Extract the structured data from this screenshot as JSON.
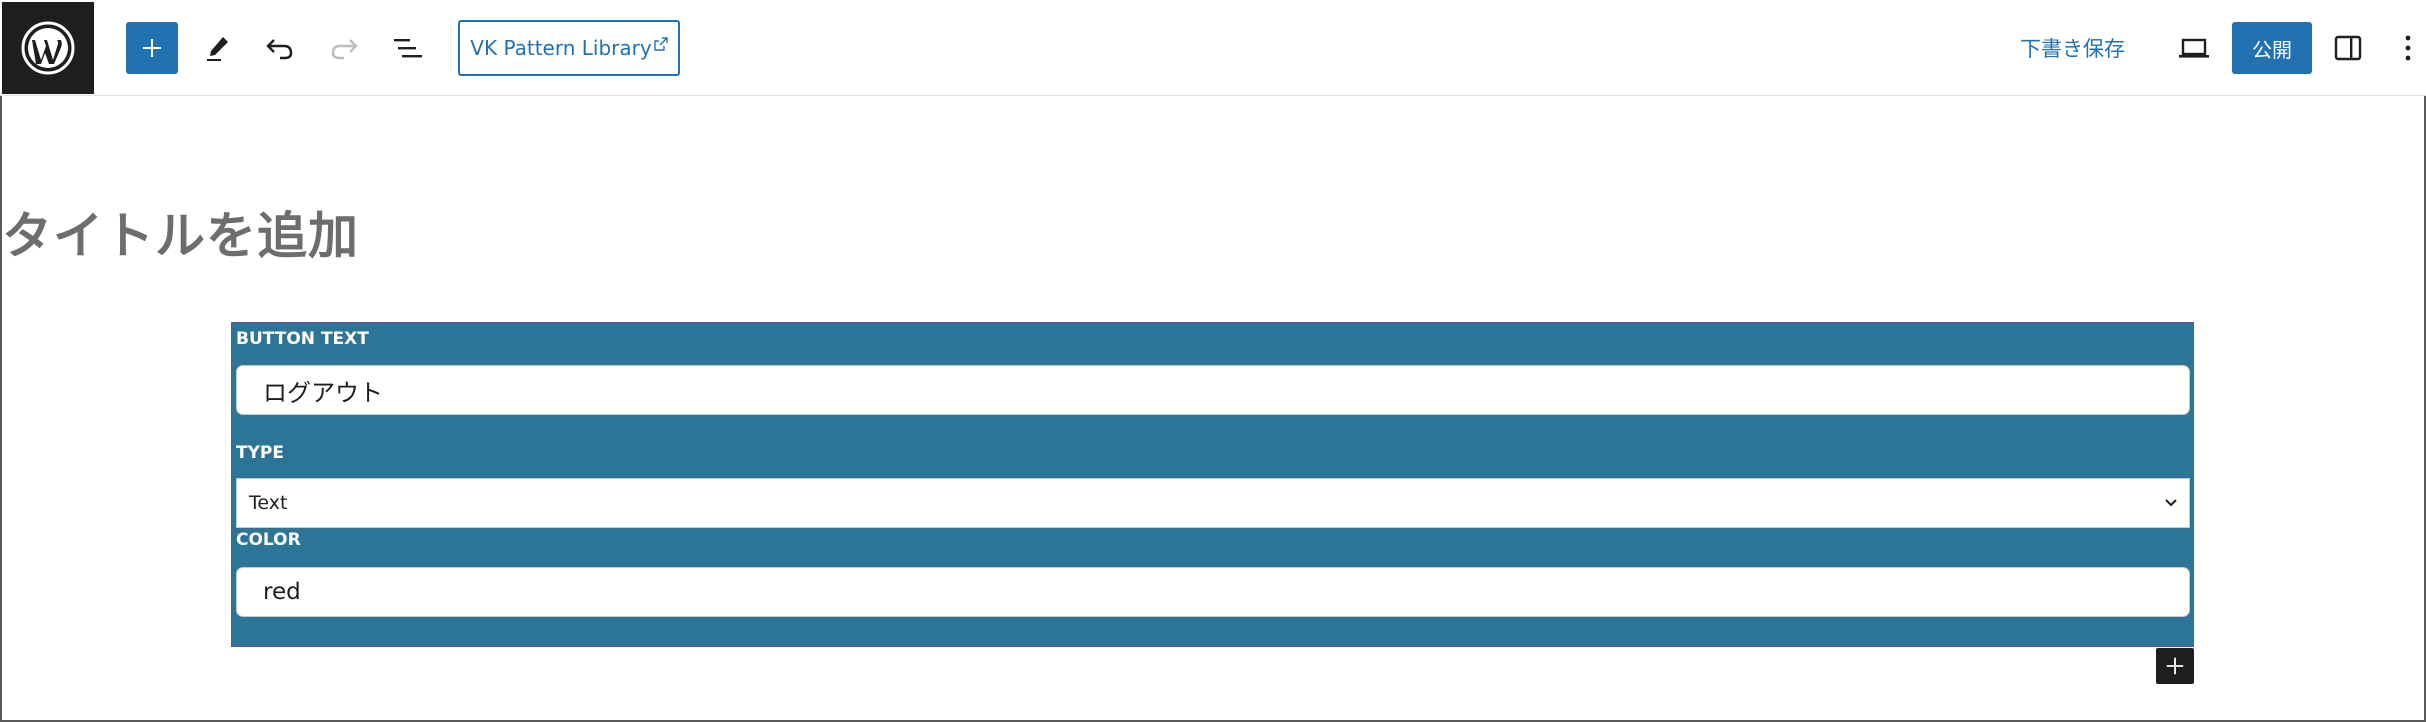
{
  "toolbar": {
    "add_block_icon": "plus-icon",
    "tools_icon": "pencil-icon",
    "undo_icon": "undo-icon",
    "redo_icon": "redo-icon",
    "list_view_icon": "list-view-icon",
    "pattern_link": "VK Pattern Library",
    "external_icon": "external-link-icon",
    "save_draft": "下書き保存",
    "preview_icon": "laptop-icon",
    "publish": "公開",
    "settings_icon": "sidebar-toggle-icon",
    "options_icon": "vertical-dots-icon",
    "accent_color": "#2271b1"
  },
  "editor": {
    "title_placeholder": "タイトルを追加"
  },
  "block": {
    "background_color": "#2d7597",
    "button_text_label": "BUTTON TEXT",
    "button_text_value": "ログアウト",
    "type_label": "TYPE",
    "type_value": "Text",
    "color_label": "COLOR",
    "color_value": "red"
  },
  "inserter_icon": "plus-icon"
}
